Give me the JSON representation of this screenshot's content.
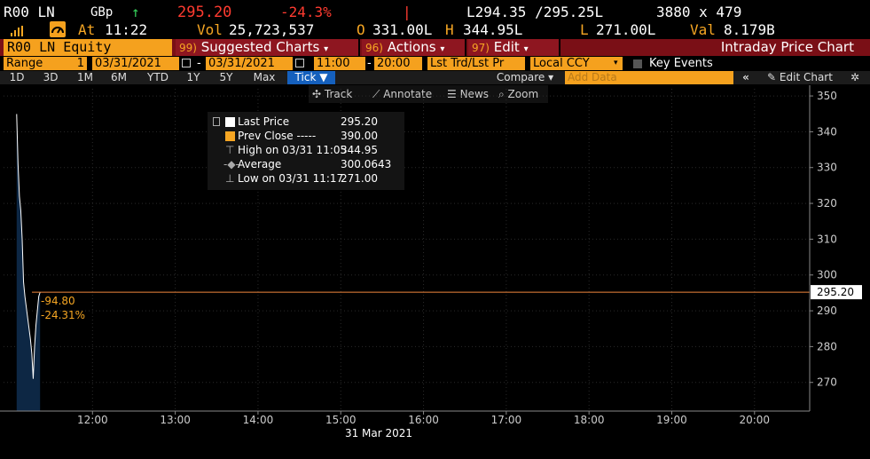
{
  "ticker": {
    "symbol": "R00 LN",
    "currency": "GBp",
    "arrow": "↑",
    "last": "295.20",
    "change_pct": "-24.3%",
    "bid_ask": "L294.35 /295.25L",
    "size": "3880 x 479",
    "at_label": "At",
    "time": "11:22",
    "vol_label": "Vol",
    "volume": "25,723,537",
    "open_label": "O",
    "open": "331.00L",
    "high_label": "H",
    "high": "344.95L",
    "low_label": "L",
    "low": "271.00L",
    "val_label": "Val",
    "val": "8.179B"
  },
  "menubar": {
    "security": "R00 LN Equity",
    "suggested_num": "99)",
    "suggested": "Suggested Charts",
    "actions_num": "96)",
    "actions": "Actions",
    "edit_num": "97)",
    "edit": "Edit",
    "chart_title": "Intraday Price Chart"
  },
  "range": {
    "label": "Range",
    "days": "1",
    "start_date": "03/31/2021",
    "end_date": "03/31/2021",
    "dash": "-",
    "start_time": "11:00",
    "end_time": "20:00",
    "price_type": "Lst Trd/Lst Pr",
    "currency": "Local CCY",
    "key_events": "Key Events"
  },
  "periods": [
    "1D",
    "3D",
    "1M",
    "6M",
    "YTD",
    "1Y",
    "5Y",
    "Max"
  ],
  "tick_label": "Tick ▼",
  "compare_label": "Compare ▾",
  "add_data_placeholder": "Add Data",
  "collapse_label": "«",
  "edit_chart_label": "✎ Edit Chart",
  "gear_label": "✲",
  "toolbar": {
    "track": "Track",
    "annotate": "Annotate",
    "news": "News",
    "zoom": "Zoom"
  },
  "legend": {
    "last_price_label": "Last Price",
    "last_price_value": "295.20",
    "prev_close_label": "Prev Close -----",
    "prev_close_value": "390.00",
    "high_label": "High on 03/31 11:05",
    "high_value": "344.95",
    "average_label": "Average",
    "average_value": "300.0643",
    "low_label": "Low on 03/31 11:17",
    "low_value": "271.00"
  },
  "annotation": {
    "change": "-94.80",
    "change_pct": "-24.31%"
  },
  "price_tag": "295.20",
  "date_label": "31 Mar 2021",
  "colors": {
    "orange": "#f6a623",
    "red": "#ff3b30",
    "green": "#35d05a",
    "area": "#0d2744",
    "reference_line": "#f0873c"
  },
  "chart_data": {
    "type": "area",
    "x_ticks": [
      "12:00",
      "13:00",
      "14:00",
      "15:00",
      "16:00",
      "17:00",
      "18:00",
      "19:00",
      "20:00"
    ],
    "y_ticks": [
      270,
      280,
      290,
      300,
      310,
      320,
      330,
      340,
      350
    ],
    "ylim": [
      262,
      352
    ],
    "reference_line": 295.2,
    "series": [
      {
        "x": [
          "11:05",
          "11:06",
          "11:07",
          "11:08",
          "11:09",
          "11:10",
          "11:11",
          "11:12",
          "11:13",
          "11:14",
          "11:15",
          "11:16",
          "11:17",
          "11:18",
          "11:19",
          "11:20",
          "11:21",
          "11:22"
        ],
        "values": [
          344.95,
          331,
          322,
          318,
          310,
          298,
          294,
          291,
          288,
          285,
          282,
          278,
          271,
          280,
          286,
          290,
          294,
          295.2
        ]
      }
    ]
  }
}
